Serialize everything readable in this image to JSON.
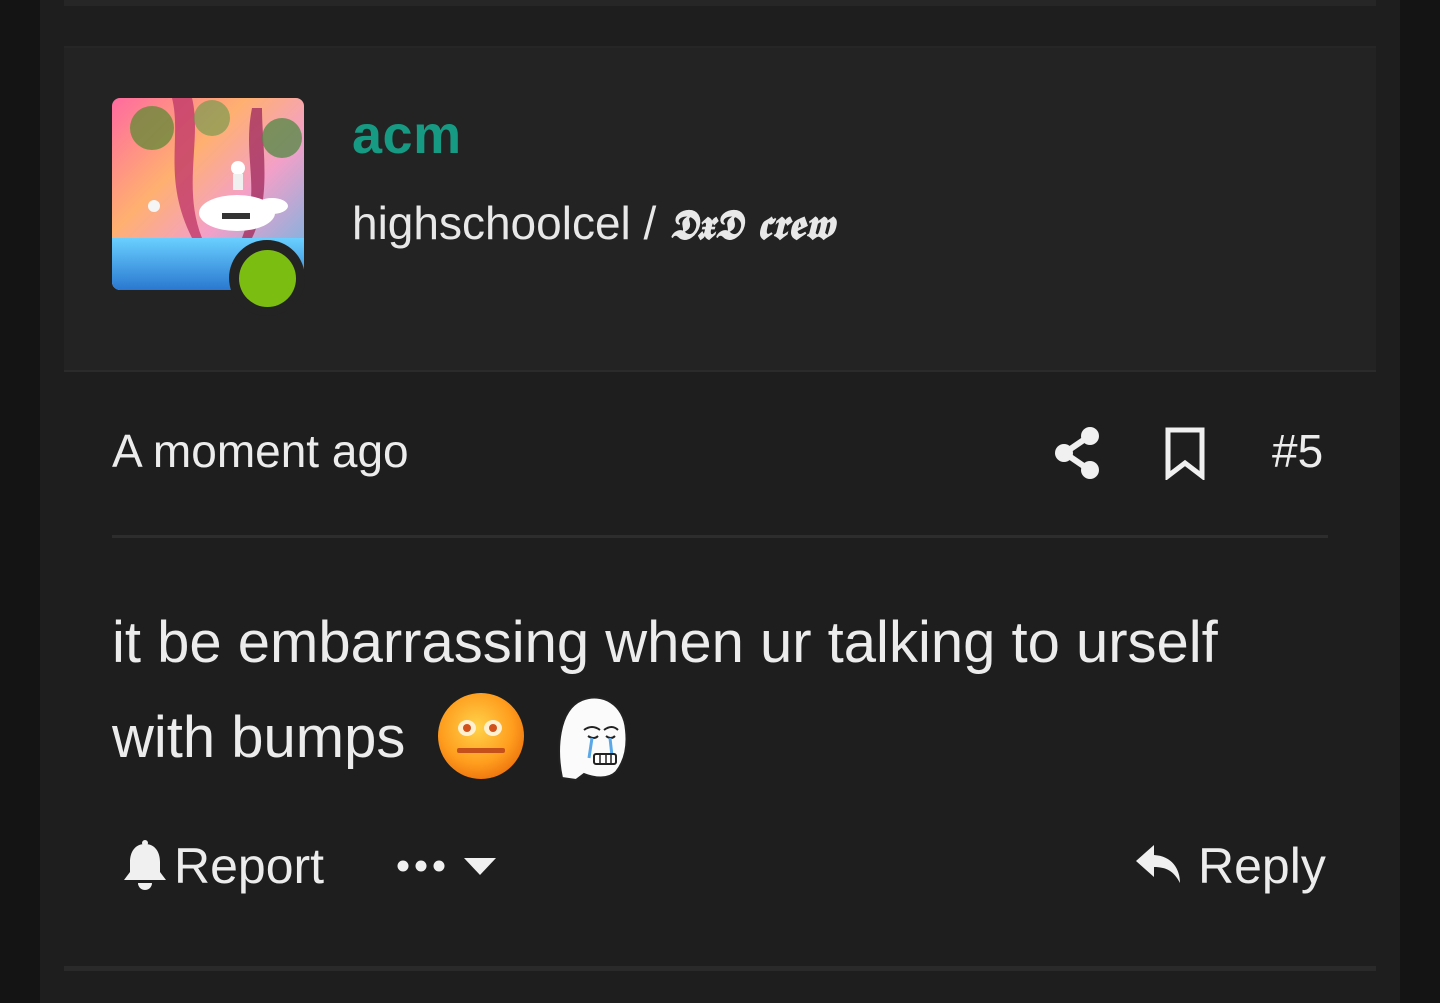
{
  "user": {
    "name": "acm",
    "title_prefix": "highschoolcel / ",
    "title_crew": "𝕯𝖝𝕯 𝖈𝖗𝖊𝖜",
    "online": true,
    "name_color": "#169a83",
    "status_color": "#7cbd12"
  },
  "post": {
    "time": "A moment ago",
    "number": "#5",
    "message_line1": "it be embarrassing when ur talking to urself",
    "message_line2": "with bumps",
    "emojis": [
      "cringe-face-emoji",
      "crying-wojak-emoji"
    ]
  },
  "header_icons": [
    "share-icon",
    "bookmark-icon"
  ],
  "actions": {
    "report_label": "Report",
    "reply_label": "Reply",
    "more_icon": "ellipsis-icon",
    "dropdown_icon": "caret-down-icon"
  }
}
